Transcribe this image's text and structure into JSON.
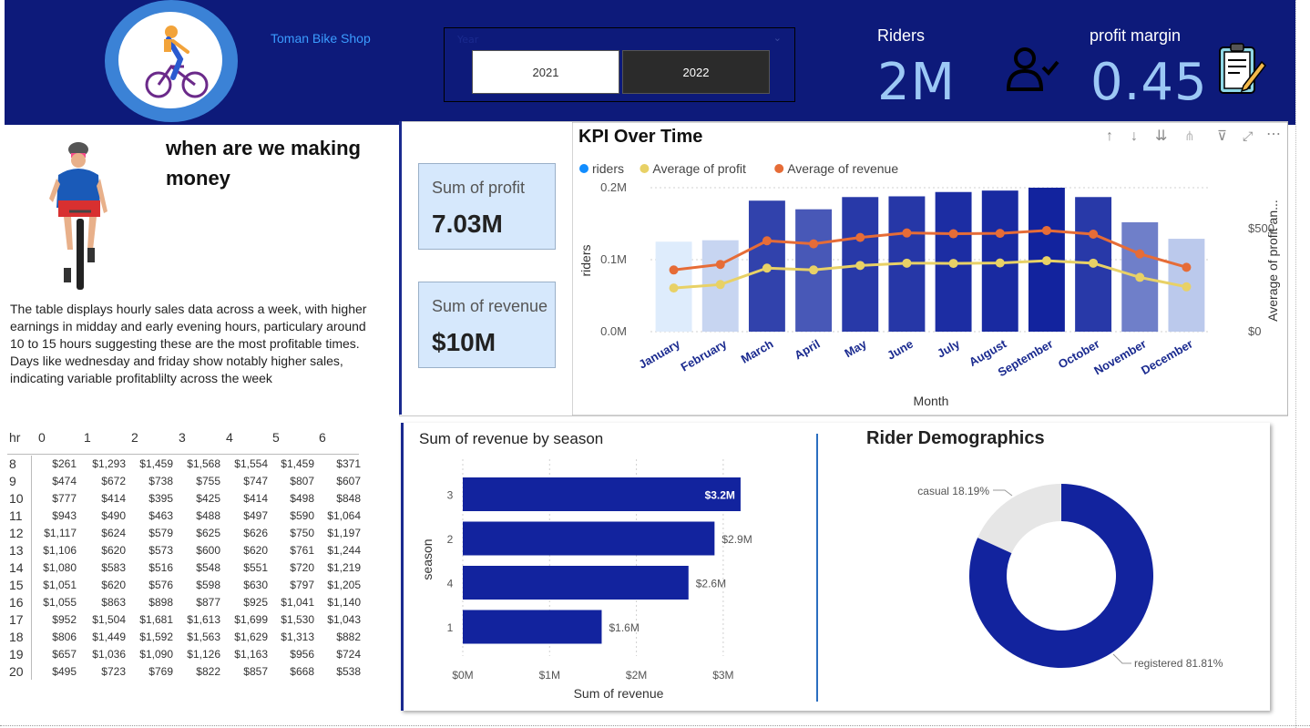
{
  "header": {
    "shop_name": "Toman Bike Shop",
    "slicer": {
      "title": "Year",
      "options": [
        "2021",
        "2022"
      ],
      "selected": "2022"
    },
    "riders_label": "Riders",
    "riders_value": "2M",
    "margin_label": "profit margin",
    "margin_value": "0.45"
  },
  "left": {
    "headline": "when are we making money",
    "description": "The table displays hourly sales data across a week, with higher earnings in midday and early evening hours, particulary around 10 to 15 hours suggesting these are the most profitable times. Days like wednesday and friday show notably higher sales, indicating variable profitablilty across the week",
    "table": {
      "row_header": "hr",
      "columns": [
        "0",
        "1",
        "2",
        "3",
        "4",
        "5",
        "6"
      ],
      "rows": [
        {
          "hr": "8",
          "vals": [
            "$261",
            "$1,293",
            "$1,459",
            "$1,568",
            "$1,554",
            "$1,459",
            "$371"
          ]
        },
        {
          "hr": "9",
          "vals": [
            "$474",
            "$672",
            "$738",
            "$755",
            "$747",
            "$807",
            "$607"
          ]
        },
        {
          "hr": "10",
          "vals": [
            "$777",
            "$414",
            "$395",
            "$425",
            "$414",
            "$498",
            "$848"
          ]
        },
        {
          "hr": "11",
          "vals": [
            "$943",
            "$490",
            "$463",
            "$488",
            "$497",
            "$590",
            "$1,064"
          ]
        },
        {
          "hr": "12",
          "vals": [
            "$1,117",
            "$624",
            "$579",
            "$625",
            "$626",
            "$750",
            "$1,197"
          ]
        },
        {
          "hr": "13",
          "vals": [
            "$1,106",
            "$620",
            "$573",
            "$600",
            "$620",
            "$761",
            "$1,244"
          ]
        },
        {
          "hr": "14",
          "vals": [
            "$1,080",
            "$583",
            "$516",
            "$548",
            "$551",
            "$720",
            "$1,219"
          ]
        },
        {
          "hr": "15",
          "vals": [
            "$1,051",
            "$620",
            "$576",
            "$598",
            "$630",
            "$797",
            "$1,205"
          ]
        },
        {
          "hr": "16",
          "vals": [
            "$1,055",
            "$863",
            "$898",
            "$877",
            "$925",
            "$1,041",
            "$1,140"
          ]
        },
        {
          "hr": "17",
          "vals": [
            "$952",
            "$1,504",
            "$1,681",
            "$1,613",
            "$1,699",
            "$1,530",
            "$1,043"
          ]
        },
        {
          "hr": "18",
          "vals": [
            "$806",
            "$1,449",
            "$1,592",
            "$1,563",
            "$1,629",
            "$1,313",
            "$882"
          ]
        },
        {
          "hr": "19",
          "vals": [
            "$657",
            "$1,036",
            "$1,090",
            "$1,126",
            "$1,163",
            "$956",
            "$724"
          ]
        },
        {
          "hr": "20",
          "vals": [
            "$495",
            "$723",
            "$769",
            "$822",
            "$857",
            "$668",
            "$538"
          ]
        }
      ]
    }
  },
  "cards": {
    "profit_label": "Sum of profit",
    "profit_value": "7.03M",
    "revenue_label": "Sum of revenue",
    "revenue_value": "$10M"
  },
  "colors": {
    "header_bg": "#0d1a7a",
    "riders": "#118dff",
    "profit": "#e8d166",
    "revenue": "#e66c37",
    "bar_navy": "#12239e"
  },
  "chart_data": [
    {
      "type": "bar",
      "title": "KPI Over Time",
      "legend": [
        "riders",
        "Average of profit",
        "Average of revenue"
      ],
      "legend_position": "top-left",
      "xlabel": "Month",
      "ylabel": "riders",
      "y2label": "Average of profit an...",
      "categories": [
        "January",
        "February",
        "March",
        "April",
        "May",
        "June",
        "July",
        "August",
        "September",
        "October",
        "November",
        "December"
      ],
      "y_ticks": [
        "0.0M",
        "0.1M",
        "0.2M"
      ],
      "y2_ticks": [
        "$0",
        "$500"
      ],
      "ylim": [
        0,
        0.2
      ],
      "y2lim": [
        0,
        700
      ],
      "series": [
        {
          "name": "riders",
          "values": [
            0.125,
            0.127,
            0.182,
            0.17,
            0.187,
            0.188,
            0.194,
            0.196,
            0.2,
            0.187,
            0.152,
            0.129
          ]
        },
        {
          "name": "Average of profit",
          "values": [
            212,
            229,
            309,
            300,
            322,
            333,
            332,
            334,
            345,
            333,
            264,
            218
          ]
        },
        {
          "name": "Average of revenue",
          "values": [
            300,
            327,
            442,
            427,
            458,
            480,
            476,
            478,
            492,
            474,
            378,
            313
          ]
        }
      ]
    },
    {
      "type": "bar",
      "orientation": "horizontal",
      "title": "Sum of revenue by season",
      "xlabel": "Sum of revenue",
      "ylabel": "season",
      "categories": [
        "3",
        "2",
        "4",
        "1"
      ],
      "values": [
        3.2,
        2.9,
        2.6,
        1.6
      ],
      "labels": [
        "$3.2M",
        "$2.9M",
        "$2.6M",
        "$1.6M"
      ],
      "x_ticks": [
        "$0M",
        "$1M",
        "$2M",
        "$3M"
      ],
      "xlim": [
        0,
        3.4
      ]
    },
    {
      "type": "pie",
      "style": "donut",
      "title": "Rider Demographics",
      "categories": [
        "casual",
        "registered"
      ],
      "values": [
        18.19,
        81.81
      ],
      "labels": [
        "casual 18.19%",
        "registered 81.81%"
      ]
    }
  ]
}
